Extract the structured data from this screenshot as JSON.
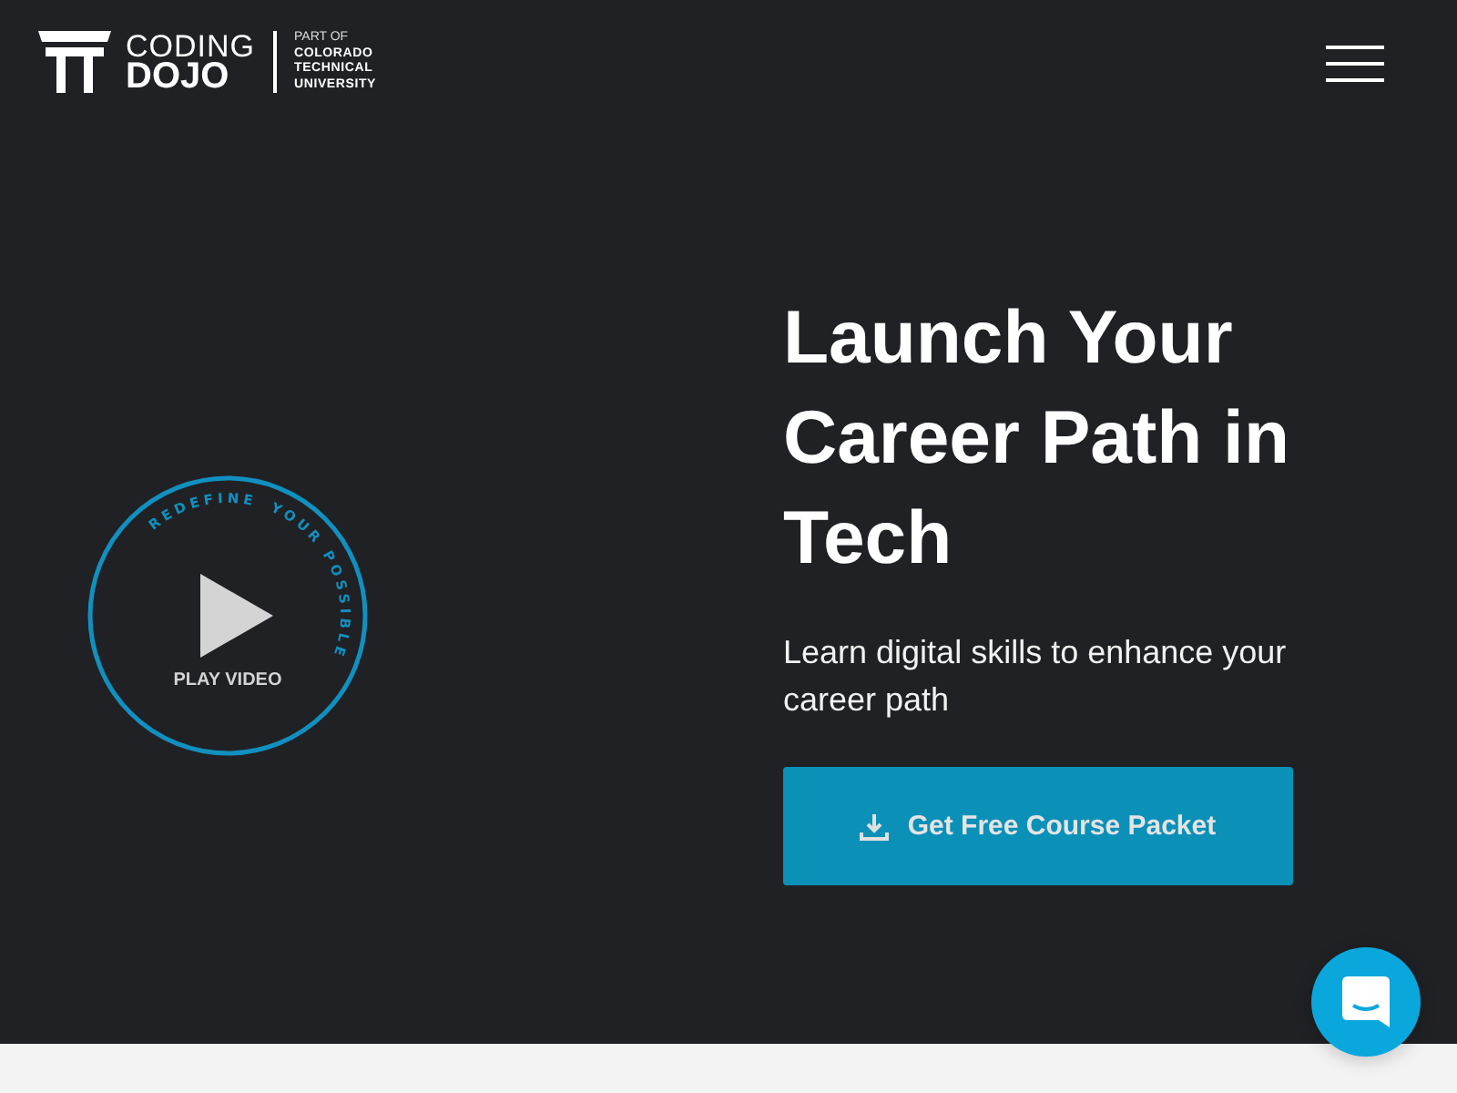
{
  "logo": {
    "line1": "CODING",
    "line2": "DOJO",
    "prefix": "PART OF",
    "affiliation": [
      "COLORADO",
      "TECHNICAL",
      "UNIVERSITY"
    ]
  },
  "hero": {
    "title": "Launch Your Career Path in Tech",
    "subtitle": "Learn digital skills to enhance your career path",
    "cta": "Get Free Course Packet"
  },
  "video": {
    "ring_words": [
      "REDEFINE",
      "YOUR",
      "POSSIBLE"
    ],
    "label": "PLAY VIDEO"
  }
}
